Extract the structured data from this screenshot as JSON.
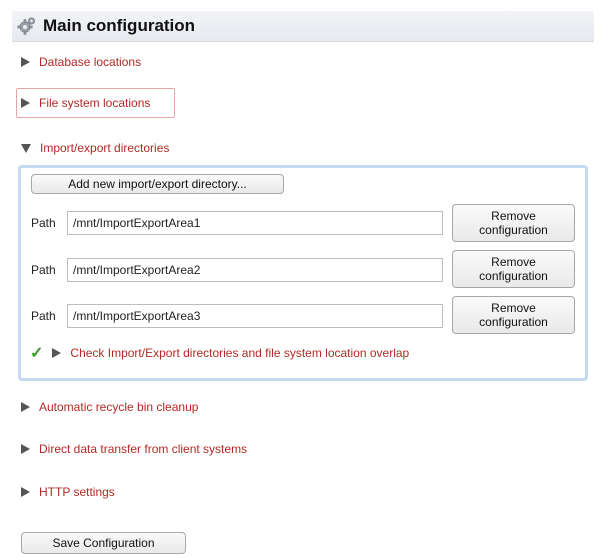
{
  "header": {
    "title": "Main configuration",
    "icon": "gear-icon"
  },
  "sections": [
    {
      "label": "Database locations",
      "expanded": false
    },
    {
      "label": "File system locations",
      "expanded": false,
      "focused": true
    },
    {
      "label": "Import/export directories",
      "expanded": true
    },
    {
      "label": "Automatic recycle bin cleanup",
      "expanded": false
    },
    {
      "label": "Direct data transfer from client systems",
      "expanded": false
    },
    {
      "label": "HTTP settings",
      "expanded": false
    }
  ],
  "import_export": {
    "add_button_label": "Add new import/export directory...",
    "path_label": "Path",
    "remove_line1": "Remove",
    "remove_line2": "configuration",
    "paths": [
      "/mnt/ImportExportArea1",
      "/mnt/ImportExportArea2",
      "/mnt/ImportExportArea3"
    ],
    "check_label": "Check Import/Export directories and file system location overlap",
    "check_status": "ok"
  },
  "footer": {
    "save_label": "Save Configuration"
  },
  "colors": {
    "section_label": "#b22a25",
    "panel_border": "#c5daf0",
    "check_mark": "#3a9a2a"
  }
}
